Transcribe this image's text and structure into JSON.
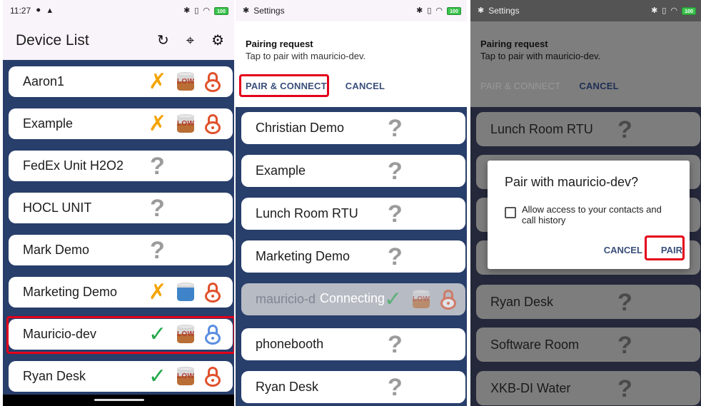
{
  "panel1": {
    "status": {
      "time": "11:27"
    },
    "header": {
      "title": "Device List"
    },
    "devices": [
      {
        "name": "Aaron1",
        "status": "error",
        "battery": "LOW",
        "lock": "orange"
      },
      {
        "name": "Example",
        "status": "error",
        "battery": "LOW",
        "lock": "orange"
      },
      {
        "name": "FedEx Unit H2O2",
        "status": "unknown"
      },
      {
        "name": "HOCL UNIT",
        "status": "unknown"
      },
      {
        "name": "Mark Demo",
        "status": "unknown"
      },
      {
        "name": "Marketing Demo",
        "status": "error",
        "battery": "full",
        "lock": "orange"
      },
      {
        "name": "Mauricio-dev",
        "status": "ok",
        "battery": "LOW",
        "lock": "blue",
        "highlighted": true
      },
      {
        "name": "Ryan Desk",
        "status": "ok",
        "battery": "LOW",
        "lock": "orange"
      }
    ]
  },
  "panel2": {
    "status": {
      "app": "Settings"
    },
    "notification": {
      "title": "Pairing request",
      "text": "Tap to pair with mauricio-dev.",
      "pair_connect": "PAIR & CONNECT",
      "cancel": "CANCEL"
    },
    "devices": [
      {
        "name": "Christian Demo"
      },
      {
        "name": "Example"
      },
      {
        "name": "Lunch Room RTU"
      },
      {
        "name": "Marketing Demo"
      },
      {
        "name": "mauricio-d",
        "overlay": "Connecting",
        "battery": "LOW"
      },
      {
        "name": "phonebooth"
      },
      {
        "name": "Ryan Desk"
      }
    ]
  },
  "panel3": {
    "status": {
      "app": "Settings"
    },
    "notification": {
      "title": "Pairing request",
      "text": "Tap to pair with mauricio-dev.",
      "pair_connect": "PAIR & CONNECT",
      "cancel": "CANCEL"
    },
    "devices": [
      {
        "name": "Lunch Room RTU"
      },
      {
        "name": "Ryan Desk"
      },
      {
        "name": "Software Room"
      },
      {
        "name": "XKB-DI Water"
      }
    ],
    "dialog": {
      "title": "Pair with mauricio-dev?",
      "checkbox_label": "Allow access to your contacts and call history",
      "cancel": "CANCEL",
      "pair": "PAIR"
    }
  },
  "colors": {
    "list_bg": "#283e6b",
    "highlight": "#e3001b",
    "ok": "#22a84a",
    "error": "#f4a300",
    "lock": "#e0522c",
    "lock_blue": "#5a8ee0"
  },
  "icons": {
    "refresh": "refresh-icon",
    "locate": "crosshair-icon",
    "settings": "gear-icon",
    "bluetooth": "bluetooth-icon"
  }
}
